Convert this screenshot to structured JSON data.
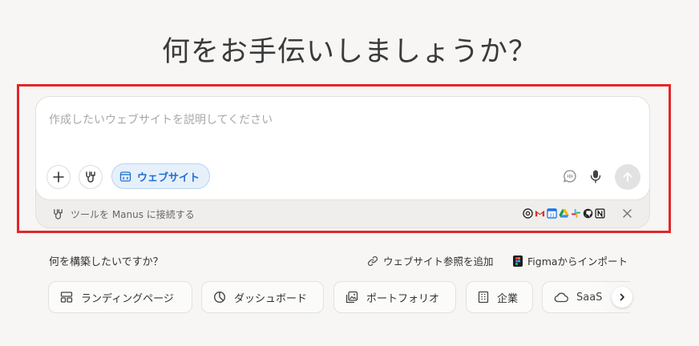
{
  "heading": "何をお手伝いしましょうか？",
  "composer": {
    "placeholder": "作成したいウェブサイトを説明してください",
    "mode_chip_label": "ウェブサイト",
    "connect_tools_label": "ツールを Manus に接続する",
    "connector_apps": [
      "chrome-icon",
      "gmail-icon",
      "calendar-icon",
      "drive-icon",
      "slack-icon",
      "github-icon",
      "notion-icon"
    ]
  },
  "suggestions": {
    "section_label": "何を構築したいですか？",
    "add_reference_label": "ウェブサイト参照を追加",
    "figma_import_label": "Figmaからインポート",
    "categories": [
      {
        "label": "ランディングページ",
        "icon": "layout-icon"
      },
      {
        "label": "ダッシュボード",
        "icon": "pie-chart-icon"
      },
      {
        "label": "ポートフォリオ",
        "icon": "images-icon"
      },
      {
        "label": "企業",
        "icon": "building-icon"
      },
      {
        "label": "SaaS",
        "icon": "cloud-icon"
      }
    ]
  },
  "colors": {
    "accent_blue": "#1f6fd1",
    "highlight_red": "#e3262b",
    "background": "#f7f6f4"
  }
}
